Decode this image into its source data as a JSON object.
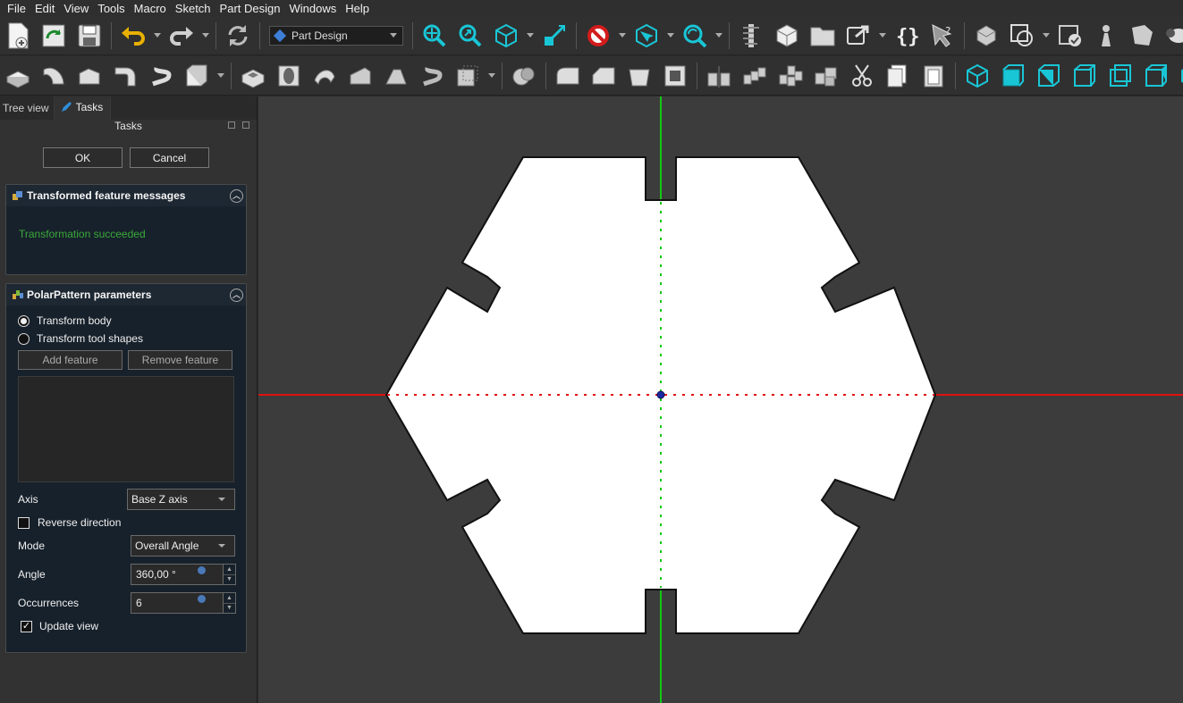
{
  "menu": [
    "File",
    "Edit",
    "View",
    "Tools",
    "Macro",
    "Sketch",
    "Part Design",
    "Windows",
    "Help"
  ],
  "toolbar1": {
    "workbench": "Part Design",
    "icons": [
      "new-file-icon",
      "open-file-icon",
      "save-icon",
      "undo-icon",
      "redo-icon",
      "refresh-icon",
      "fit-all-icon",
      "fit-selection-icon",
      "view-isometric-icon",
      "measure-icon",
      "no-drawstyle-icon",
      "box-select-icon",
      "zoom-icon",
      "measure-distance-icon",
      "part-icon",
      "folder-icon",
      "link-icon",
      "macro-braces-icon",
      "whats-this-icon",
      "body-icon",
      "sketch-icon",
      "validate-sketch-icon",
      "pawn-icon",
      "shape-icon",
      "sheep-icon",
      "datum-plane-icon"
    ]
  },
  "toolbar2": {
    "icons": [
      "pad-icon",
      "revolution-icon",
      "loft-icon",
      "pipe-icon",
      "helix-icon",
      "primitive-add-icon",
      "pocket-icon",
      "hole-icon",
      "groove-icon",
      "subtractive-loft-icon",
      "subtractive-pipe-icon",
      "subtractive-helix-icon",
      "primitive-subtract-icon",
      "boolean-icon",
      "fillet-icon",
      "chamfer-icon",
      "draft-icon",
      "thickness-icon",
      "mirrored-icon",
      "linear-pattern-icon",
      "polar-pattern-icon",
      "multi-transform-icon",
      "scissors-icon",
      "copy-icon",
      "paste-icon",
      "view-front-icon",
      "view-top-icon",
      "view-right-icon",
      "view-rear-icon",
      "view-bottom-icon",
      "view-left-icon",
      "view-axo-icon"
    ]
  },
  "panel": {
    "tabs": [
      "Tree view",
      "Tasks"
    ],
    "title": "Tasks",
    "ok": "OK",
    "cancel": "Cancel",
    "messages_box": {
      "title": "Transformed feature messages",
      "message": "Transformation succeeded"
    },
    "params_box": {
      "title": "PolarPattern parameters",
      "radio_body": "Transform body",
      "radio_tool": "Transform tool shapes",
      "add_feature": "Add feature",
      "remove_feature": "Remove feature",
      "axis_label": "Axis",
      "axis_value": "Base Z axis",
      "reverse_label": "Reverse direction",
      "mode_label": "Mode",
      "mode_value": "Overall Angle",
      "angle_label": "Angle",
      "angle_value": "360,00 °",
      "occurrences_label": "Occurrences",
      "occurrences_value": "6",
      "update_label": "Update view"
    }
  },
  "colors": {
    "x_axis": "#e01010",
    "y_axis": "#14c814",
    "shape_fill": "#ffffff",
    "shape_edge": "#111111",
    "success": "#3aa93a"
  }
}
